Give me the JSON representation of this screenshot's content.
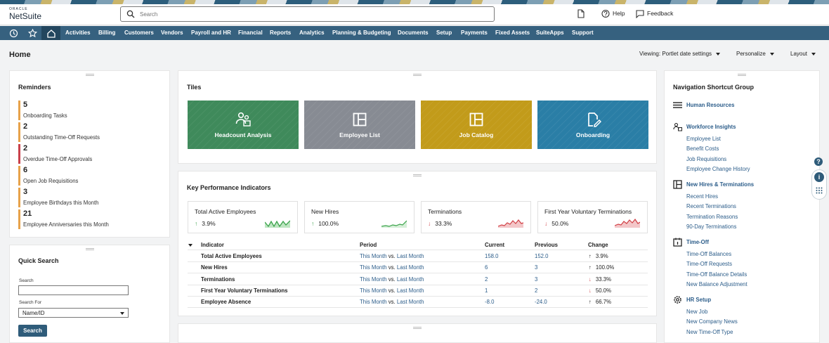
{
  "brand": {
    "oracle": "ORACLE",
    "netsuite": "NetSuite"
  },
  "search": {
    "placeholder": "Search"
  },
  "topbar": {
    "help": "Help",
    "feedback": "Feedback"
  },
  "nav": {
    "items": [
      "Activities",
      "Billing",
      "Customers",
      "Vendors",
      "Payroll and HR",
      "Financial",
      "Reports",
      "Analytics",
      "Planning & Budgeting",
      "Documents",
      "Setup",
      "Payments",
      "Fixed Assets",
      "SuiteApps",
      "Support"
    ]
  },
  "page": {
    "title": "Home",
    "viewing": "Viewing: Portlet date settings",
    "personalize": "Personalize",
    "layout": "Layout"
  },
  "reminders": {
    "title": "Reminders",
    "items": [
      {
        "count": "5",
        "label": "Onboarding Tasks",
        "color": "#e7a24a"
      },
      {
        "count": "2",
        "label": "Outstanding Time-Off Requests",
        "color": "#e7a24a"
      },
      {
        "count": "2",
        "label": "Overdue Time-Off Approvals",
        "color": "#c9404a"
      },
      {
        "count": "6",
        "label": "Open Job Requisitions",
        "color": "#e7a24a"
      },
      {
        "count": "3",
        "label": "Employee Birthdays this Month",
        "color": "#e7a24a"
      },
      {
        "count": "21",
        "label": "Employee Anniversaries this Month",
        "color": "#e7a24a"
      }
    ]
  },
  "quick_search": {
    "title": "Quick Search",
    "search_label": "Search",
    "search_for_label": "Search For",
    "search_for_value": "Name/ID",
    "button": "Search"
  },
  "tiles": {
    "title": "Tiles",
    "items": [
      {
        "label": "Headcount Analysis",
        "color": "#3f8a5b",
        "icon": "people-icon"
      },
      {
        "label": "Employee List",
        "color": "#878b93",
        "icon": "grid-icon"
      },
      {
        "label": "Job Catalog",
        "color": "#c29b1a",
        "icon": "grid-icon"
      },
      {
        "label": "Onboarding",
        "color": "#2a7ea6",
        "icon": "edit-document-icon"
      }
    ]
  },
  "kpi": {
    "title": "Key Performance Indicators",
    "cards": [
      {
        "title": "Total Active Employees",
        "value": "3.9%",
        "trend": "up",
        "color": "#3aa34a"
      },
      {
        "title": "New Hires",
        "value": "100.0%",
        "trend": "up",
        "color": "#3aa34a"
      },
      {
        "title": "Terminations",
        "value": "33.3%",
        "trend": "down",
        "color": "#d13f45"
      },
      {
        "title": "First Year Voluntary Terminations",
        "value": "50.0%",
        "trend": "down",
        "color": "#d13f45"
      }
    ],
    "table": {
      "headers": [
        "Indicator",
        "Period",
        "Current",
        "Previous",
        "Change"
      ],
      "rows": [
        {
          "indicator": "Total Active Employees",
          "period_a": "This Month",
          "vs": "vs.",
          "period_b": "Last Month",
          "current": "158.0",
          "previous": "152.0",
          "change": "3.9%",
          "trend": "up"
        },
        {
          "indicator": "New Hires",
          "period_a": "This Month",
          "vs": "vs.",
          "period_b": "Last Month",
          "current": "6",
          "previous": "3",
          "change": "100.0%",
          "trend": "up"
        },
        {
          "indicator": "Terminations",
          "period_a": "This Month",
          "vs": "vs.",
          "period_b": "Last Month",
          "current": "2",
          "previous": "3",
          "change": "33.3%",
          "trend": "down"
        },
        {
          "indicator": "First Year Voluntary Terminations",
          "period_a": "This Month",
          "vs": "vs.",
          "period_b": "Last Month",
          "current": "1",
          "previous": "2",
          "change": "50.0%",
          "trend": "down"
        },
        {
          "indicator": "Employee Absence",
          "period_a": "This Month",
          "vs": "vs.",
          "period_b": "Last Month",
          "current": "-8.0",
          "previous": "-24.0",
          "change": "66.7%",
          "trend": "up"
        }
      ]
    }
  },
  "nav_shortcuts": {
    "title": "Navigation Shortcut Group",
    "groups": [
      {
        "heading": "Human Resources",
        "icon": "menu-icon",
        "items": []
      },
      {
        "heading": "Workforce Insights",
        "icon": "people-icon",
        "items": [
          "Employee List",
          "Benefit Costs",
          "Job Requisitions",
          "Employee Change History"
        ]
      },
      {
        "heading": "New Hires & Terminations",
        "icon": "grid-icon",
        "items": [
          "Recent Hires",
          "Recent Terminations",
          "Termination Reasons",
          "90-Day Terminations"
        ]
      },
      {
        "heading": "Time-Off",
        "icon": "calendar-icon",
        "items": [
          "Time-Off Balances",
          "Time-Off Requests",
          "Time-Off Balance Details",
          "New Balance Adjustment"
        ]
      },
      {
        "heading": "HR Setup",
        "icon": "gear-icon",
        "items": [
          "New Job",
          "New Company News",
          "New Time-Off Type"
        ]
      }
    ]
  }
}
